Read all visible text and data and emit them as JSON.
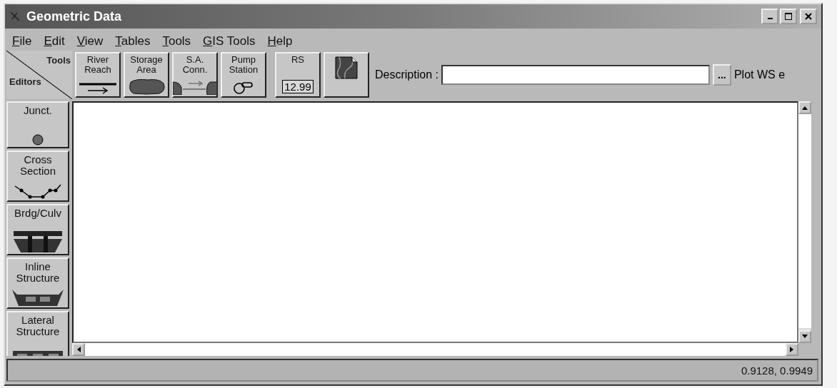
{
  "window": {
    "title": "Geometric Data"
  },
  "menu": [
    {
      "label": "File"
    },
    {
      "label": "Edit"
    },
    {
      "label": "View"
    },
    {
      "label": "Tables"
    },
    {
      "label": "Tools"
    },
    {
      "label": "GIS Tools"
    },
    {
      "label": "Help"
    }
  ],
  "corner": {
    "top": "Tools",
    "bottom": "Editors"
  },
  "tools": [
    {
      "kind": "reach",
      "label": "River Reach"
    },
    {
      "kind": "storage",
      "label": "Storage Area"
    },
    {
      "kind": "conn",
      "label": "S.A. Conn."
    },
    {
      "kind": "pump",
      "label": "Pump Station"
    },
    {
      "kind": "rs",
      "label": "RS",
      "tag": "12.99"
    },
    {
      "kind": "map"
    }
  ],
  "description": {
    "label": "Description :",
    "more": "..."
  },
  "plot_label": "Plot WS e",
  "editors": [
    {
      "kind": "junction",
      "label": "Junct."
    },
    {
      "kind": "xs",
      "label": "Cross Section"
    },
    {
      "kind": "bridge",
      "label": "Brdg/Culv"
    },
    {
      "kind": "inline",
      "label": "Inline Structure"
    },
    {
      "kind": "lateral",
      "label": "Lateral Structure"
    }
  ],
  "status_bar": {
    "coordinates": "0.9128, 0.9949"
  }
}
